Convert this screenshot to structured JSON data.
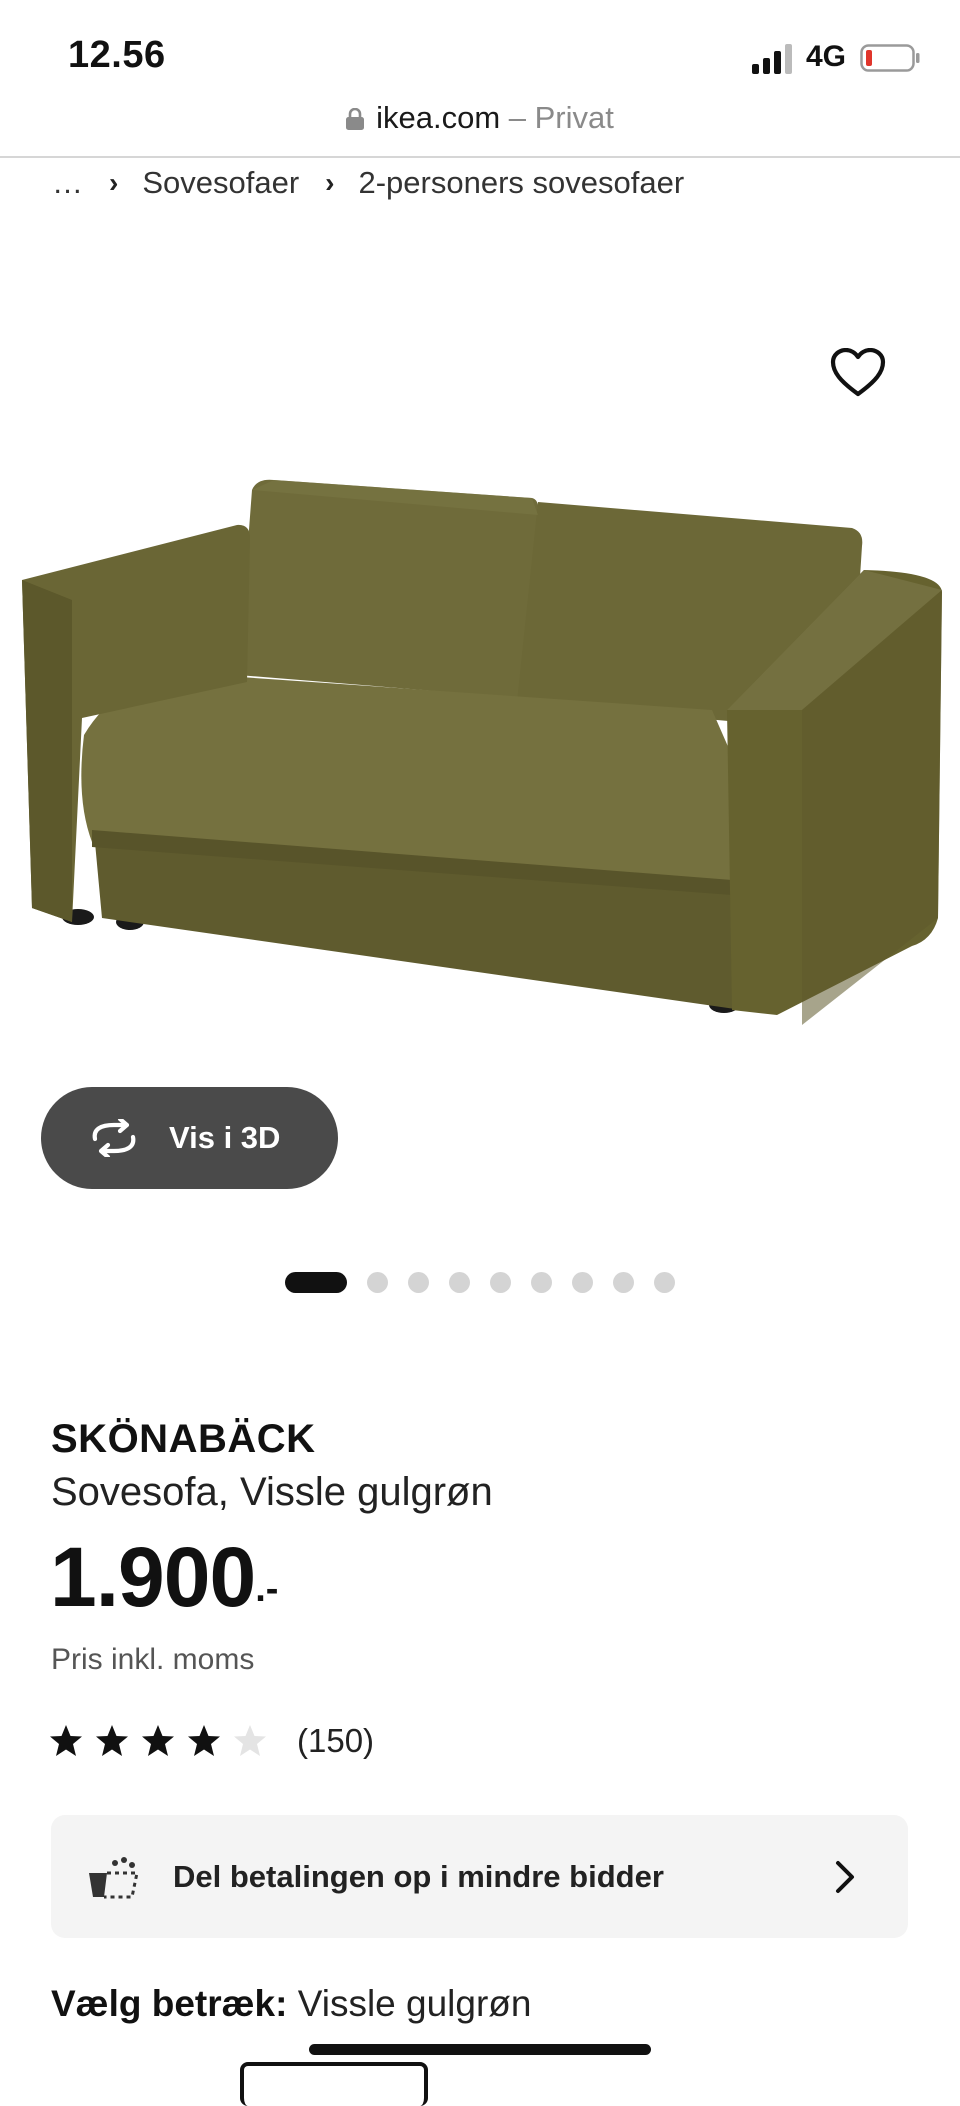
{
  "status_bar": {
    "time": "12.56",
    "network": "4G",
    "signal_icon": "signal-bars-icon",
    "battery_icon": "battery-low-icon",
    "battery_color": "#e0352b"
  },
  "url_bar": {
    "domain": "ikea.com",
    "mode": "– Privat"
  },
  "breadcrumb": {
    "items": [
      "…",
      "Sovesofaer",
      "2-personers sovesofaer"
    ]
  },
  "gallery": {
    "favorite_icon": "heart-outline-icon",
    "view_3d_label": "Vis i 3D",
    "dots_total": 10,
    "active_dot": 1
  },
  "product": {
    "name": "SKÖNABÄCK",
    "description": "Sovesofa, Vissle gulgrøn",
    "price": "1.900",
    "price_suffix": ".-",
    "price_note": "Pris inkl. moms",
    "rating": {
      "stars": 4,
      "max": 5,
      "reviews": "(150)"
    },
    "sofa_color": "#6e6a3a"
  },
  "payment": {
    "label": "Del betalingen op i mindre bidder",
    "icon": "payment-basket-icon"
  },
  "cover": {
    "label": "Vælg betræk:",
    "value": "Vissle gulgrøn"
  }
}
